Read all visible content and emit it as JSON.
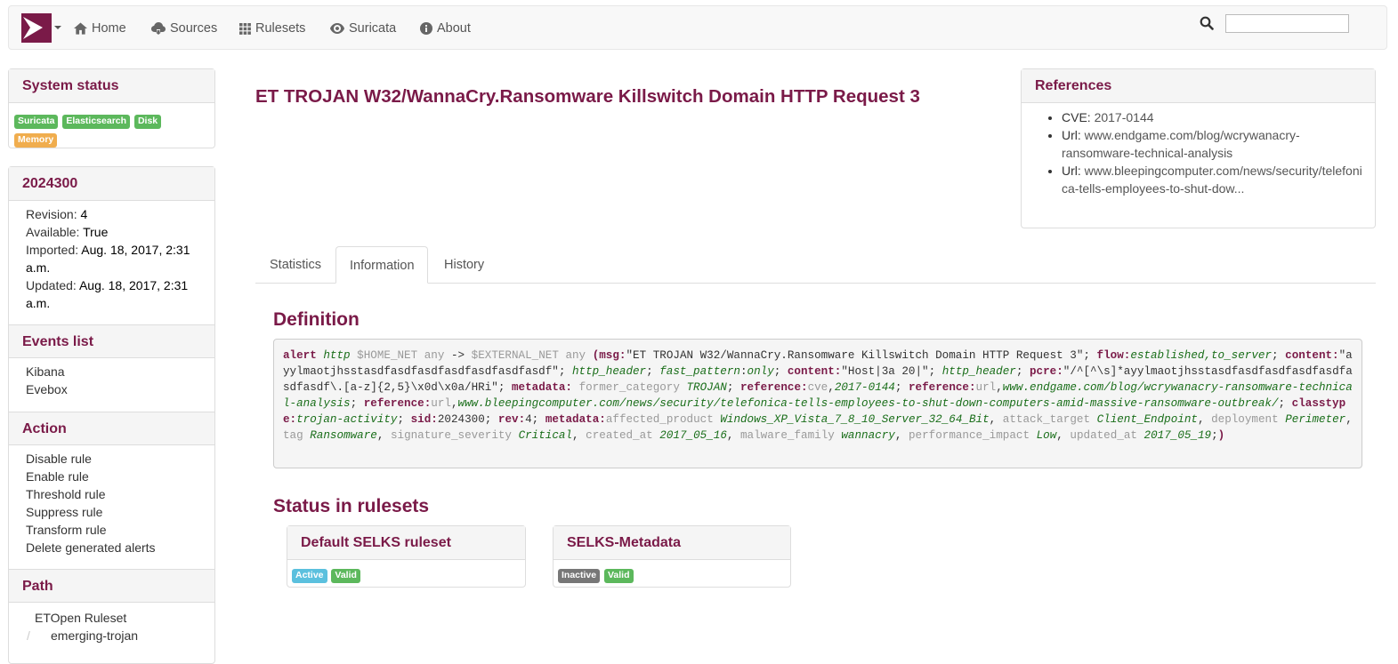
{
  "nav": {
    "items": [
      {
        "icon": "home-icon",
        "label": "Home"
      },
      {
        "icon": "cloud-download-icon",
        "label": "Sources"
      },
      {
        "icon": "grid-icon",
        "label": "Rulesets"
      },
      {
        "icon": "eye-icon",
        "label": "Suricata"
      },
      {
        "icon": "info-icon",
        "label": "About"
      }
    ],
    "search_value": ""
  },
  "system_status": {
    "title": "System status",
    "badges": [
      {
        "label": "Suricata",
        "color": "#5cb85c"
      },
      {
        "label": "Elasticsearch",
        "color": "#5cb85c"
      },
      {
        "label": "Disk",
        "color": "#5cb85c"
      },
      {
        "label": "Memory",
        "color": "#f0ad4e"
      }
    ]
  },
  "rule": {
    "sid": "2024300",
    "revision_label": "Revision:",
    "revision": "4",
    "available_label": "Available:",
    "available": "True",
    "imported_label": "Imported:",
    "imported": "Aug. 18, 2017, 2:31 a.m.",
    "updated_label": "Updated:",
    "updated": "Aug. 18, 2017, 2:31 a.m.",
    "title": "ET TROJAN W32/WannaCry.Ransomware Killswitch Domain HTTP Request 3"
  },
  "events_list": {
    "title": "Events list",
    "items": [
      "Kibana",
      "Evebox"
    ]
  },
  "action": {
    "title": "Action",
    "items": [
      "Disable rule",
      "Enable rule",
      "Threshold rule",
      "Suppress rule",
      "Transform rule",
      "Delete generated alerts"
    ]
  },
  "path": {
    "title": "Path",
    "items": [
      "ETOpen Ruleset",
      "emerging-trojan"
    ],
    "separator": "/"
  },
  "references": {
    "title": "References",
    "items": [
      {
        "key": "CVE:",
        "value": "2017-0144"
      },
      {
        "key": "Url:",
        "value": "www.endgame.com/blog/wcrywanacry-ransomware-technical-analysis"
      },
      {
        "key": "Url:",
        "value": "www.bleepingcomputer.com/news/security/telefonica-tells-employees-to-shut-dow..."
      }
    ]
  },
  "tabs": [
    "Statistics",
    "Information",
    "History"
  ],
  "definition": {
    "title": "Definition",
    "parts": [
      {
        "t": "k",
        "s": "alert"
      },
      {
        "t": "n",
        "s": " "
      },
      {
        "t": "v",
        "s": "http"
      },
      {
        "t": "n",
        "s": " "
      },
      {
        "t": "g",
        "s": "$HOME_NET any"
      },
      {
        "t": "n",
        "s": " -> "
      },
      {
        "t": "g",
        "s": "$EXTERNAL_NET any"
      },
      {
        "t": "n",
        "s": " "
      },
      {
        "t": "p",
        "s": "("
      },
      {
        "t": "k",
        "s": "msg:"
      },
      {
        "t": "n",
        "s": "\"ET TROJAN W32/WannaCry.Ransomware Killswitch Domain HTTP Request 3\"; "
      },
      {
        "t": "k",
        "s": "flow:"
      },
      {
        "t": "v",
        "s": "established,to_server"
      },
      {
        "t": "n",
        "s": "; "
      },
      {
        "t": "k",
        "s": "content:"
      },
      {
        "t": "n",
        "s": "\"ayylmaotjhsstasdfasdfasdfasdfasdfasdfasdf\"; "
      },
      {
        "t": "v",
        "s": "http_header"
      },
      {
        "t": "n",
        "s": "; "
      },
      {
        "t": "v",
        "s": "fast_pattern"
      },
      {
        "t": "n",
        "s": ":"
      },
      {
        "t": "v",
        "s": "only"
      },
      {
        "t": "n",
        "s": "; "
      },
      {
        "t": "k",
        "s": "content:"
      },
      {
        "t": "n",
        "s": "\"Host|3a 20|\"; "
      },
      {
        "t": "v",
        "s": "http_header"
      },
      {
        "t": "n",
        "s": "; "
      },
      {
        "t": "k",
        "s": "pcre:"
      },
      {
        "t": "n",
        "s": "\"/^[^\\s]*ayylmaotjhsstasdfasdfasdfasdfasdfasdfasdf\\.[a-z]{2,5}\\x0d\\x0a/HRi\"; "
      },
      {
        "t": "k",
        "s": "metadata:"
      },
      {
        "t": "n",
        "s": " "
      },
      {
        "t": "g",
        "s": "former_category"
      },
      {
        "t": "n",
        "s": " "
      },
      {
        "t": "v",
        "s": "TROJAN"
      },
      {
        "t": "n",
        "s": "; "
      },
      {
        "t": "k",
        "s": "reference:"
      },
      {
        "t": "g",
        "s": "cve"
      },
      {
        "t": "n",
        "s": ","
      },
      {
        "t": "v",
        "s": "2017-0144"
      },
      {
        "t": "n",
        "s": "; "
      },
      {
        "t": "k",
        "s": "reference:"
      },
      {
        "t": "g",
        "s": "url"
      },
      {
        "t": "n",
        "s": ","
      },
      {
        "t": "v",
        "s": "www.endgame.com/blog/wcrywanacry-ransomware-technical-analysis"
      },
      {
        "t": "n",
        "s": "; "
      },
      {
        "t": "k",
        "s": "reference:"
      },
      {
        "t": "g",
        "s": "url"
      },
      {
        "t": "n",
        "s": ","
      },
      {
        "t": "v",
        "s": "www.bleepingcomputer.com/news/security/telefonica-tells-employees-to-shut-down-computers-amid-massive-ransomware-outbreak/"
      },
      {
        "t": "n",
        "s": "; "
      },
      {
        "t": "k",
        "s": "classtype:"
      },
      {
        "t": "v",
        "s": "trojan-activity"
      },
      {
        "t": "n",
        "s": "; "
      },
      {
        "t": "k",
        "s": "sid:"
      },
      {
        "t": "n",
        "s": "2024300; "
      },
      {
        "t": "k",
        "s": "rev:"
      },
      {
        "t": "n",
        "s": "4; "
      },
      {
        "t": "k",
        "s": "metadata:"
      },
      {
        "t": "g",
        "s": "affected_product"
      },
      {
        "t": "n",
        "s": " "
      },
      {
        "t": "v",
        "s": "Windows_XP_Vista_7_8_10_Server_32_64_Bit"
      },
      {
        "t": "n",
        "s": ", "
      },
      {
        "t": "g",
        "s": "attack_target"
      },
      {
        "t": "n",
        "s": " "
      },
      {
        "t": "v",
        "s": "Client_Endpoint"
      },
      {
        "t": "n",
        "s": ", "
      },
      {
        "t": "g",
        "s": "deployment"
      },
      {
        "t": "n",
        "s": " "
      },
      {
        "t": "v",
        "s": "Perimeter"
      },
      {
        "t": "n",
        "s": ", "
      },
      {
        "t": "g",
        "s": "tag"
      },
      {
        "t": "n",
        "s": " "
      },
      {
        "t": "v",
        "s": "Ransomware"
      },
      {
        "t": "n",
        "s": ", "
      },
      {
        "t": "g",
        "s": "signature_severity"
      },
      {
        "t": "n",
        "s": " "
      },
      {
        "t": "v",
        "s": "Critical"
      },
      {
        "t": "n",
        "s": ", "
      },
      {
        "t": "g",
        "s": "created_at"
      },
      {
        "t": "n",
        "s": " "
      },
      {
        "t": "v",
        "s": "2017_05_16"
      },
      {
        "t": "n",
        "s": ", "
      },
      {
        "t": "g",
        "s": "malware_family"
      },
      {
        "t": "n",
        "s": " "
      },
      {
        "t": "v",
        "s": "wannacry"
      },
      {
        "t": "n",
        "s": ", "
      },
      {
        "t": "g",
        "s": "performance_impact"
      },
      {
        "t": "n",
        "s": " "
      },
      {
        "t": "v",
        "s": "Low"
      },
      {
        "t": "n",
        "s": ", "
      },
      {
        "t": "g",
        "s": "updated_at"
      },
      {
        "t": "n",
        "s": " "
      },
      {
        "t": "v",
        "s": "2017_05_19"
      },
      {
        "t": "n",
        "s": ";"
      },
      {
        "t": "p",
        "s": ")"
      }
    ]
  },
  "status_in_rulesets": {
    "title": "Status in rulesets",
    "rulesets": [
      {
        "name": "Default SELKS ruleset",
        "badges": [
          {
            "label": "Active",
            "color": "#5bc0de"
          },
          {
            "label": "Valid",
            "color": "#5cb85c"
          }
        ]
      },
      {
        "name": "SELKS-Metadata",
        "badges": [
          {
            "label": "Inactive",
            "color": "#777777"
          },
          {
            "label": "Valid",
            "color": "#5cb85c"
          }
        ]
      }
    ]
  }
}
